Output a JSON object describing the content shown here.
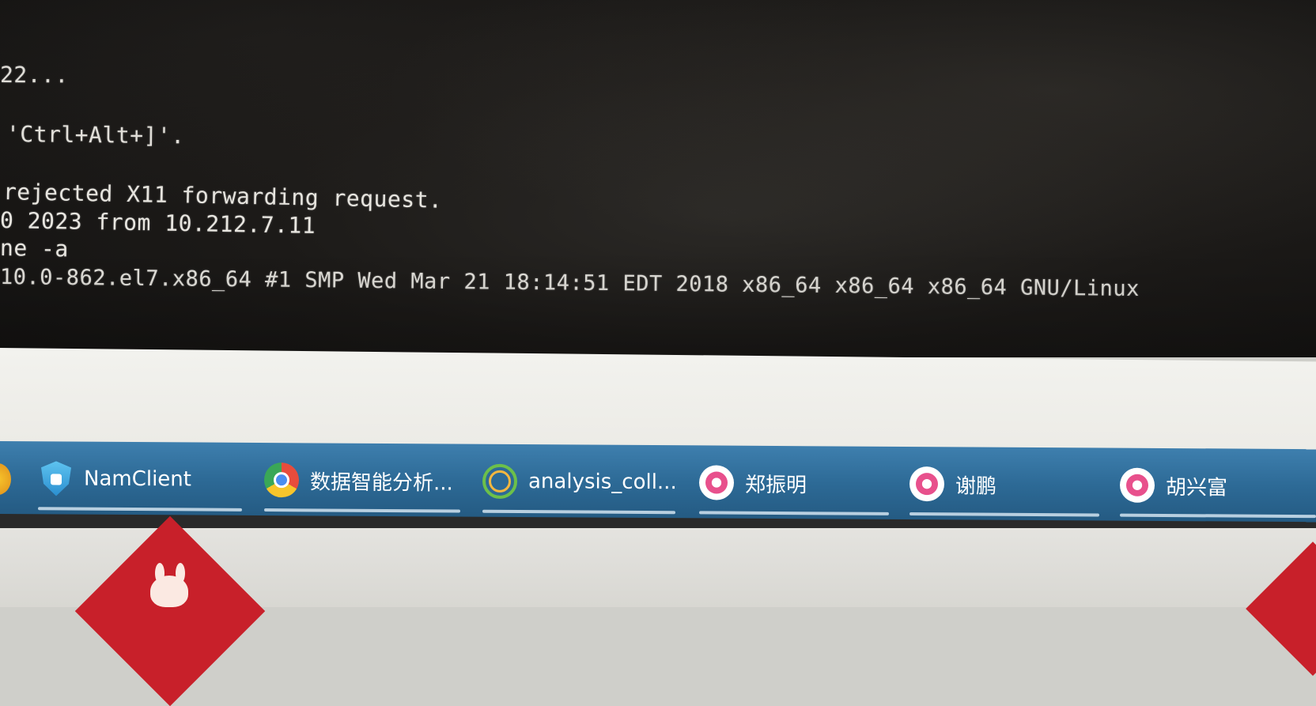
{
  "terminal": {
    "lines": [
      "22...",
      "'Ctrl+Alt+]'.",
      "rejected X11 forwarding request.",
      "0 2023 from 10.212.7.11",
      "ne -a",
      "10.0-862.el7.x86_64 #1 SMP Wed Mar 21 18:14:51 EDT 2018 x86_64 x86_64 x86_64 GNU/Linux"
    ]
  },
  "taskbar": {
    "items": [
      {
        "label": "NamClient",
        "icon": "shield-icon"
      },
      {
        "label": "数据智能分析...",
        "icon": "chrome-icon"
      },
      {
        "label": "analysis_coll...",
        "icon": "anaconda-icon"
      },
      {
        "label": "郑振明",
        "icon": "chat-avatar-icon"
      },
      {
        "label": "谢鹏",
        "icon": "chat-avatar-icon"
      },
      {
        "label": "胡兴富",
        "icon": "chat-avatar-icon"
      }
    ]
  },
  "colors": {
    "terminal_bg": "#1c1a18",
    "terminal_text": "#e8e6e0",
    "taskbar": "#2d6a96",
    "desk": "#dcdbd6",
    "sticker": "#c8202a"
  }
}
